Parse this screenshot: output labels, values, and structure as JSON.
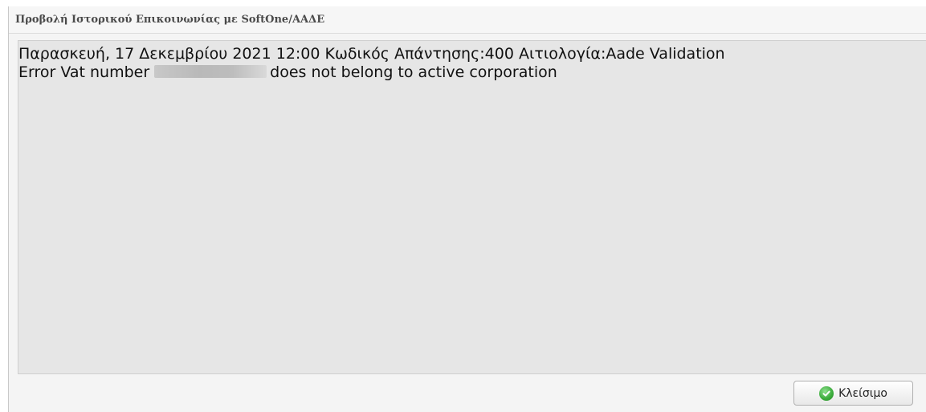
{
  "dialog": {
    "title": "Προβολή Ιστορικού Επικοινωνίας με SoftOne/ΑΑΔΕ",
    "message_line1": "Παρασκευή, 17 Δεκεμβρίου 2021 12:00 Κωδικός Απάντησης:400 Αιτιολογία:Aade Validation",
    "message_line2_prefix": "Error Vat number",
    "message_line2_suffix": "does not belong to active corporation",
    "close_label": "Κλείσιμο"
  },
  "icons": {
    "close_button_icon": "check-circle-icon"
  }
}
